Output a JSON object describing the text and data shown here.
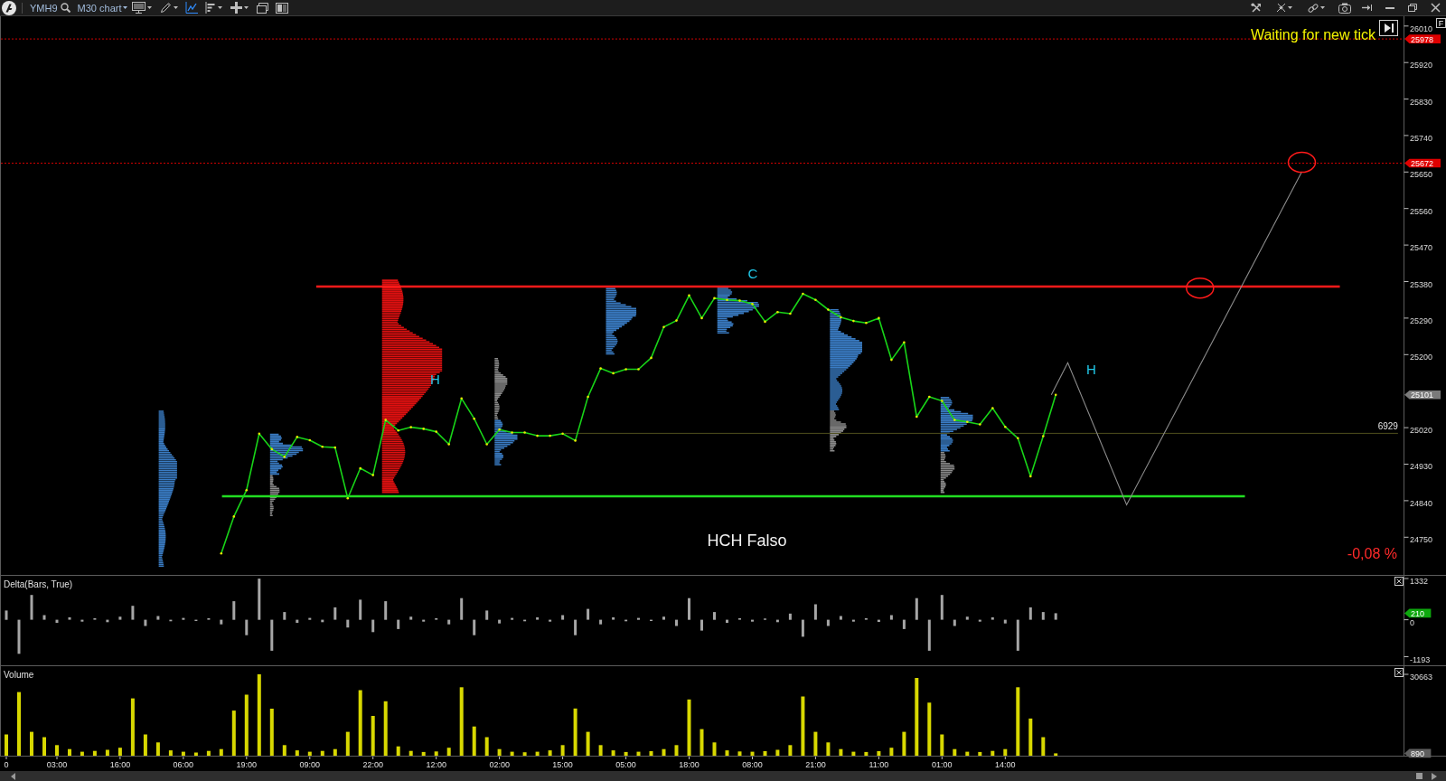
{
  "toolbar": {
    "symbol": "YMH9",
    "timeframe": {
      "label": "M30 chart",
      "dropdown": true
    },
    "tools": [
      {
        "dropdown": true,
        "selected": false
      },
      {
        "dropdown": true,
        "selected": false
      },
      {
        "dropdown": false,
        "selected": true
      },
      {
        "dropdown": true,
        "selected": false
      },
      {
        "dropdown": true,
        "selected": false
      },
      {
        "dropdown": false,
        "selected": false
      },
      {
        "dropdown": false,
        "selected": false
      }
    ],
    "right_tools": [
      {
        "dropdown": false
      },
      {
        "dropdown": true
      },
      {
        "dropdown": true
      },
      {
        "dropdown": false
      },
      {
        "dropdown": false
      }
    ]
  },
  "price_chart": {
    "status": "Waiting for new tick",
    "change": "-0,08 %",
    "axis_button": "F",
    "caption": "HCH Falso",
    "volume_label": "6929",
    "last_price": "25101",
    "chart_data": {
      "type": "line",
      "categories": [
        null,
        null,
        null,
        null,
        null,
        null,
        null,
        null,
        null,
        null,
        null,
        null,
        null,
        null,
        null,
        null,
        null,
        null,
        null,
        null,
        null,
        null,
        null,
        null,
        null,
        null,
        null,
        null,
        null,
        null,
        null,
        null,
        null,
        null,
        null,
        null,
        null,
        null,
        null,
        null,
        null,
        null,
        null,
        null,
        null,
        null,
        null,
        null,
        null,
        null,
        null,
        null,
        null,
        null,
        null,
        null,
        null,
        null,
        null,
        null,
        null,
        null,
        null,
        null,
        null,
        null,
        null,
        null,
        null,
        null,
        null,
        null,
        null,
        null,
        null,
        null,
        null,
        null,
        null,
        null,
        null,
        null,
        null,
        null,
        null,
        null,
        null,
        null,
        null,
        null,
        null,
        null,
        null,
        null,
        null,
        null,
        null,
        null,
        null,
        null,
        null,
        null,
        null,
        null,
        null,
        null,
        null,
        null,
        null,
        null,
        null
      ],
      "values": [
        null,
        null,
        null,
        null,
        null,
        null,
        null,
        null,
        null,
        null,
        null,
        null,
        null,
        null,
        null,
        null,
        null,
        24710,
        24801,
        24866,
        25005,
        24967,
        24948,
        24997,
        24989,
        24973,
        24971,
        24846,
        24920,
        24903,
        25039,
        25013,
        25021,
        25017,
        25010,
        24979,
        25092,
        25042,
        24979,
        25015,
        25008,
        25008,
        25000,
        25000,
        25005,
        24988,
        25096,
        25166,
        25154,
        25164,
        25164,
        25192,
        25268,
        25284,
        25346,
        25290,
        25339,
        25335,
        25333,
        25325,
        25281,
        25305,
        25301,
        25350,
        25335,
        25311,
        25292,
        25283,
        25278,
        25290,
        25187,
        25230,
        25047,
        25096,
        25086,
        25039,
        25034,
        25028,
        25068,
        25022,
        24994,
        24900,
        24999,
        25101,
        null,
        null,
        null,
        null,
        null,
        null,
        null,
        null,
        null,
        null,
        null,
        null,
        null,
        null,
        null,
        null,
        null,
        null,
        null,
        null,
        null,
        null,
        null,
        null,
        null,
        null,
        null
      ],
      "ylim": [
        24657,
        26034
      ],
      "yticks": [
        24750,
        24840,
        24930,
        25020,
        25200,
        25290,
        25380,
        25470,
        25560,
        25650,
        25740,
        25830,
        25920,
        26010
      ],
      "ref_lines": [
        {
          "axis": "y",
          "value": 25978,
          "label": "25978"
        },
        {
          "axis": "y",
          "value": 25672,
          "label": "25672"
        },
        {
          "axis": "y",
          "value": 25368
        },
        {
          "axis": "y",
          "value": 24851
        }
      ],
      "annotations": [
        "C",
        "H",
        "H"
      ]
    }
  },
  "delta_pane": {
    "title": "Delta(Bars, True)",
    "last_value": "210",
    "chart_data": {
      "type": "bar",
      "categories": [
        null,
        null,
        null,
        null,
        null,
        null,
        null,
        null,
        null,
        null,
        null,
        null,
        null,
        null,
        null,
        null,
        null,
        null,
        null,
        null,
        null,
        null,
        null,
        null,
        null,
        null,
        null,
        null,
        null,
        null,
        null,
        null,
        null,
        null,
        null,
        null,
        null,
        null,
        null,
        null,
        null,
        null,
        null,
        null,
        null,
        null,
        null,
        null,
        null,
        null,
        null,
        null,
        null,
        null,
        null,
        null,
        null,
        null,
        null,
        null,
        null,
        null,
        null,
        null,
        null,
        null,
        null,
        null,
        null,
        null,
        null,
        null,
        null,
        null,
        null,
        null,
        null,
        null,
        null,
        null,
        null,
        null,
        null,
        null,
        null,
        null,
        null,
        null,
        null,
        null,
        null,
        null,
        null,
        null,
        null,
        null,
        null,
        null,
        null,
        null,
        null,
        null,
        null,
        null,
        null,
        null,
        null,
        null,
        null,
        null,
        null
      ],
      "values": [
        300,
        -1100,
        800,
        150,
        -100,
        80,
        -60,
        50,
        -80,
        100,
        450,
        -200,
        120,
        -50,
        60,
        -40,
        50,
        -150,
        600,
        -500,
        1330,
        -1000,
        250,
        -100,
        60,
        -80,
        400,
        -250,
        650,
        -400,
        600,
        -300,
        100,
        -60,
        50,
        -150,
        700,
        -500,
        300,
        -120,
        60,
        -50,
        80,
        -60,
        150,
        -500,
        350,
        -150,
        80,
        -50,
        60,
        -40,
        100,
        -200,
        700,
        -350,
        250,
        -100,
        50,
        -60,
        40,
        -80,
        200,
        -550,
        500,
        -200,
        120,
        -60,
        50,
        -70,
        150,
        -300,
        700,
        -1000,
        800,
        -200,
        100,
        -60,
        80,
        -120,
        -1000,
        400,
        250,
        210,
        null,
        null,
        null,
        null,
        null,
        null,
        null,
        null,
        null,
        null,
        null,
        null,
        null,
        null,
        null,
        null,
        null,
        null,
        null,
        null,
        null,
        null,
        null,
        null,
        null,
        null,
        null
      ],
      "ylim": [
        -1470,
        1449
      ],
      "yticks": [
        -1193,
        0,
        1332
      ]
    }
  },
  "volume_pane": {
    "title": "Volume",
    "chart_data": {
      "type": "bar",
      "categories": [
        "0",
        null,
        null,
        null,
        "03:00",
        null,
        null,
        null,
        null,
        "16:00",
        null,
        null,
        null,
        null,
        "06:00",
        null,
        null,
        null,
        null,
        "19:00",
        null,
        null,
        null,
        null,
        "09:00",
        null,
        null,
        null,
        null,
        "22:00",
        null,
        null,
        null,
        null,
        "12:00",
        null,
        null,
        null,
        null,
        "02:00",
        null,
        null,
        null,
        null,
        "15:00",
        null,
        null,
        null,
        null,
        "05:00",
        null,
        null,
        null,
        null,
        "18:00",
        null,
        null,
        null,
        null,
        "08:00",
        null,
        null,
        null,
        null,
        "21:00",
        null,
        null,
        null,
        null,
        "11:00",
        null,
        null,
        null,
        null,
        "01:00",
        null,
        null,
        null,
        null,
        "14:00",
        null,
        null,
        null,
        null,
        null,
        null,
        null,
        null,
        null,
        null,
        null,
        null,
        null,
        null,
        null,
        null,
        null,
        null,
        null,
        null,
        null,
        null,
        null,
        null,
        null,
        null,
        null,
        null,
        null,
        null,
        null
      ],
      "values": [
        8000,
        24000,
        9000,
        7000,
        4000,
        2500,
        1500,
        1800,
        2200,
        3000,
        21600,
        8000,
        5000,
        2000,
        1500,
        1200,
        1800,
        2500,
        17000,
        23000,
        30700,
        17700,
        4000,
        2000,
        1500,
        1800,
        2500,
        9000,
        24700,
        15000,
        20500,
        3500,
        1800,
        1400,
        1600,
        3000,
        25800,
        11000,
        7000,
        2500,
        1500,
        1300,
        1500,
        2000,
        4000,
        17800,
        9000,
        4000,
        2000,
        1400,
        1500,
        1700,
        2500,
        4000,
        21200,
        10000,
        5000,
        2000,
        1600,
        1500,
        1700,
        2200,
        4000,
        22300,
        9000,
        5000,
        2500,
        1500,
        1400,
        1700,
        3000,
        9000,
        29300,
        20000,
        8000,
        2500,
        1500,
        1400,
        1800,
        2500,
        25800,
        14000,
        7000,
        900,
        null,
        null,
        null,
        null,
        null,
        null,
        null,
        null,
        null,
        null,
        null,
        null,
        null,
        null,
        null,
        null,
        null,
        null,
        null,
        null,
        null,
        null,
        null,
        null,
        null,
        null,
        null
      ],
      "ylim": [
        0,
        34070
      ],
      "yticks": [
        890,
        30663
      ]
    }
  }
}
